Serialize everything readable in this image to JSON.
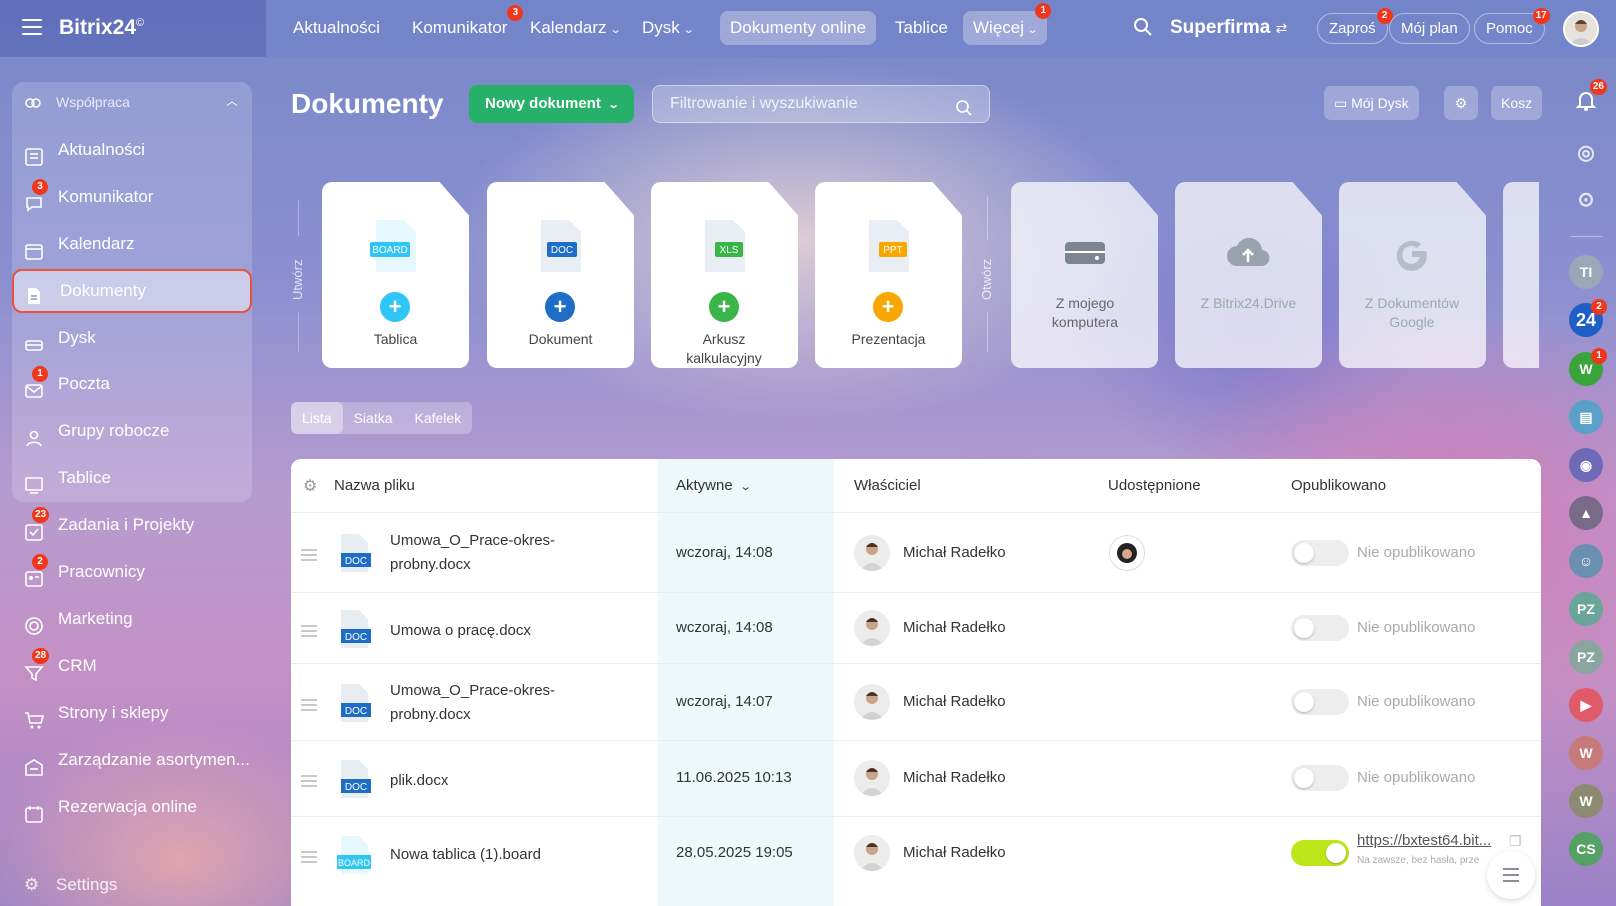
{
  "app": {
    "name": "Bitrix24",
    "mark": "©"
  },
  "nav": {
    "items": [
      {
        "label": "Aktualności"
      },
      {
        "label": "Komunikator",
        "badge": "3"
      },
      {
        "label": "Kalendarz"
      },
      {
        "label": "Dysk"
      },
      {
        "label": "Dokumenty online"
      },
      {
        "label": "Tablice"
      },
      {
        "label": "Więcej",
        "badge": "1"
      }
    ],
    "company": "Superfirma",
    "invite": {
      "label": "Zaproś",
      "badge": "2"
    },
    "plan": "Mój plan",
    "help": {
      "label": "Pomoc",
      "badge": "17"
    }
  },
  "sidebar": {
    "group_label": "Współpraca",
    "items": [
      {
        "label": "Aktualności"
      },
      {
        "label": "Komunikator",
        "badge": "3"
      },
      {
        "label": "Kalendarz"
      },
      {
        "label": "Dokumenty"
      },
      {
        "label": "Dysk"
      },
      {
        "label": "Poczta",
        "badge": "1"
      },
      {
        "label": "Grupy robocze"
      },
      {
        "label": "Tablice"
      },
      {
        "label": "Zadania i Projekty",
        "badge": "23"
      },
      {
        "label": "Pracownicy",
        "badge": "2"
      },
      {
        "label": "Marketing"
      },
      {
        "label": "CRM",
        "badge": "28"
      },
      {
        "label": "Strony i sklepy"
      },
      {
        "label": "Zarządzanie asortymen..."
      },
      {
        "label": "Rezerwacja online"
      }
    ],
    "settings": "Settings"
  },
  "page": {
    "title": "Dokumenty",
    "new_doc": "Nowy dokument",
    "filter_placeholder": "Filtrowanie i wyszukiwanie",
    "my_drive": "Mój Dysk",
    "trash": "Kosz",
    "notif_badge": "26"
  },
  "create": {
    "section_label": "Utwórz",
    "cards": [
      {
        "label": "Tablica",
        "tag": "BOARD",
        "color": "#2fc6f6"
      },
      {
        "label": "Dokument",
        "tag": "DOC",
        "color": "#1e6ec8"
      },
      {
        "label": "Arkusz kalkulacyjny",
        "tag": "XLS",
        "color": "#39b54a"
      },
      {
        "label": "Prezentacja",
        "tag": "PPT",
        "color": "#f7a700"
      }
    ]
  },
  "open": {
    "section_label": "Otwórz",
    "cards": [
      {
        "label": "Z mojego komputera"
      },
      {
        "label": "Z Bitrix24.Drive"
      },
      {
        "label": "Z Dokumentów Google"
      }
    ]
  },
  "views": [
    "Lista",
    "Siatka",
    "Kafelek"
  ],
  "table": {
    "headers": {
      "name": "Nazwa pliku",
      "active": "Aktywne",
      "owner": "Właściciel",
      "shared": "Udostępnione",
      "published": "Opublikowano"
    },
    "rows": [
      {
        "name": "Umowa_O_Prace-okres-probny.docx",
        "type": "DOC",
        "date": "wczoraj, 14:08",
        "owner": "Michał Radełko",
        "shared": true,
        "published": false,
        "status": "Nie opublikowano"
      },
      {
        "name": "Umowa o pracę.docx",
        "type": "DOC",
        "date": "wczoraj, 14:08",
        "owner": "Michał Radełko",
        "shared": false,
        "published": false,
        "status": "Nie opublikowano"
      },
      {
        "name": "Umowa_O_Prace-okres-probny.docx",
        "type": "DOC",
        "date": "wczoraj, 14:07",
        "owner": "Michał Radełko",
        "shared": false,
        "published": false,
        "status": "Nie opublikowano"
      },
      {
        "name": "plik.docx",
        "type": "DOC",
        "date": "11.06.2025 10:13",
        "owner": "Michał Radełko",
        "shared": false,
        "published": false,
        "status": "Nie opublikowano"
      },
      {
        "name": "Nowa tablica (1).board",
        "type": "BOARD",
        "date": "28.05.2025 19:05",
        "owner": "Michał Radełko",
        "shared": false,
        "published": true,
        "status": "https://bxtest64.bit...",
        "status_sub": "Na zawsze, bez hasła, prze"
      }
    ]
  },
  "right_bar": {
    "items": [
      {
        "label": "TI",
        "color": "#9aa7b8"
      },
      {
        "label": "24",
        "color": "#1d5fc6",
        "badge": "2"
      },
      {
        "label": "W",
        "color": "#3aa33a",
        "badge": "1"
      },
      {
        "label": "PZ",
        "color": "#6aa59a"
      },
      {
        "label": "PZ",
        "color": "#6aa59a"
      },
      {
        "label": "W",
        "color": "#c67a7a"
      },
      {
        "label": "W",
        "color": "#8c8a70"
      },
      {
        "label": "CS",
        "color": "#55a065"
      }
    ]
  }
}
